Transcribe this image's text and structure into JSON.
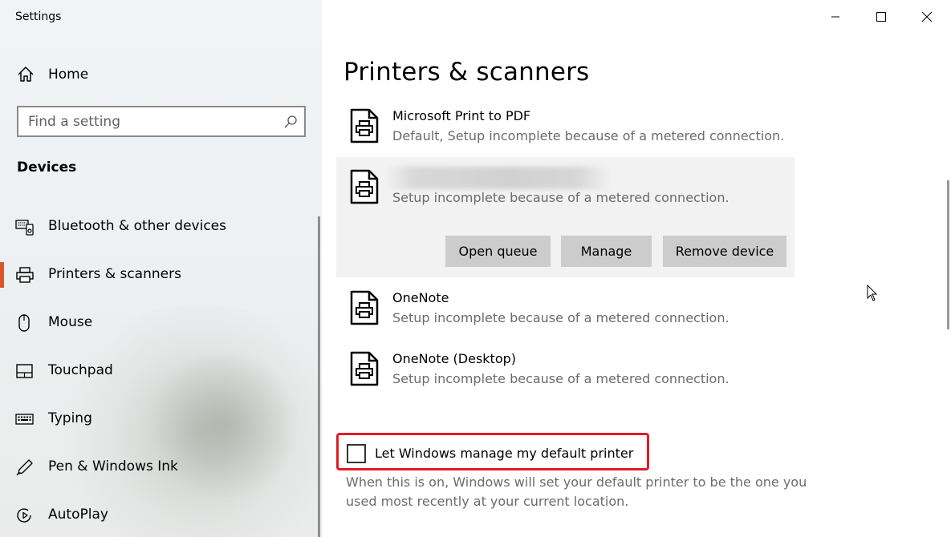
{
  "window": {
    "title": "Settings"
  },
  "sidebar": {
    "home_label": "Home",
    "search_placeholder": "Find a setting",
    "section_title": "Devices",
    "items": [
      {
        "label": "Bluetooth & other devices",
        "icon": "bluetooth-devices-icon",
        "active": false
      },
      {
        "label": "Printers & scanners",
        "icon": "printer-icon",
        "active": true
      },
      {
        "label": "Mouse",
        "icon": "mouse-icon",
        "active": false
      },
      {
        "label": "Touchpad",
        "icon": "touchpad-icon",
        "active": false
      },
      {
        "label": "Typing",
        "icon": "keyboard-icon",
        "active": false
      },
      {
        "label": "Pen & Windows Ink",
        "icon": "pen-icon",
        "active": false
      },
      {
        "label": "AutoPlay",
        "icon": "autoplay-icon",
        "active": false
      }
    ],
    "accent_color": "#d9552a"
  },
  "main": {
    "title": "Printers & scanners",
    "printers": [
      {
        "name": "Microsoft Print to PDF",
        "status": "Default, Setup incomplete because of a metered connection."
      },
      {
        "name": "",
        "status": "Setup incomplete because of a metered connection.",
        "selected": true
      },
      {
        "name": "OneNote",
        "status": "Setup incomplete because of a metered connection."
      },
      {
        "name": "OneNote (Desktop)",
        "status": "Setup incomplete because of a metered connection."
      }
    ],
    "actions": {
      "open_queue": "Open queue",
      "manage": "Manage",
      "remove_device": "Remove device"
    },
    "default_printer": {
      "label": "Let Windows manage my default printer",
      "checked": false,
      "help": "When this is on, Windows will set your default printer to be the one you used most recently at your current location."
    },
    "highlight_color": "#e31b23"
  }
}
